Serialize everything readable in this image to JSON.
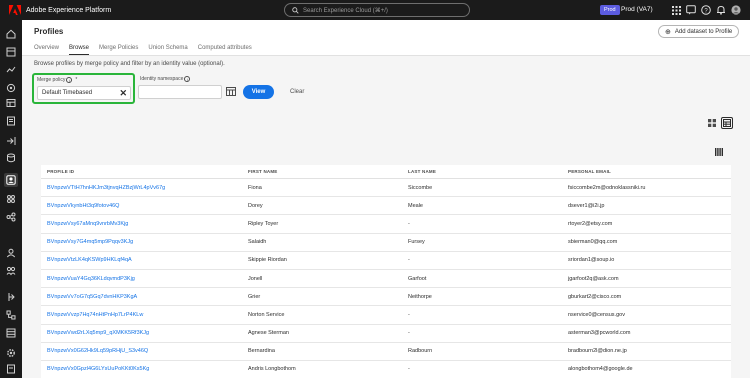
{
  "app": {
    "title": "Adobe Experience Platform"
  },
  "search": {
    "placeholder": "Search Experience Cloud (⌘+/)"
  },
  "org": {
    "badge": "Prod",
    "name": "Prod (VA7)"
  },
  "page": {
    "title": "Profiles",
    "add_dataset_label": "Add dataset to Profile",
    "tabs": [
      "Overview",
      "Browse",
      "Merge Policies",
      "Union Schema",
      "Computed attributes"
    ],
    "active_tab": "Browse",
    "description": "Browse profiles by merge policy and filter by an identity value (optional)."
  },
  "filters": {
    "merge_policy_label": "Merge policy",
    "required_mark": "*",
    "merge_policy_value": "Default Timebased",
    "identity_namespace_label": "Identity namespace",
    "view_label": "View",
    "clear_label": "Clear"
  },
  "table": {
    "headers": [
      "PROFILE ID",
      "FIRST NAME",
      "LAST NAME",
      "PERSONAL EMAIL"
    ],
    "rows": [
      [
        "BVnpzwVTtH7hnHKJm3tjnvqHZBzjWrL4pVv67g",
        "Fiona",
        "Siccombe",
        "fsiccombe2m@odnoklassniki.ru"
      ],
      [
        "BVnpzwVkynbHt3q9fotov46Q",
        "Dorey",
        "Meale",
        "dsever1@i2i.jp"
      ],
      [
        "BVnpzwVsy67aMnq9vnrbMv3Kjg",
        "Ripley Toyer",
        "-",
        "rtoyer2@etsy.com"
      ],
      [
        "BVnpzwVsy7G4mq5mp9Pqqv3KJg",
        "Salaidh",
        "Fursey",
        "sbierman0@qq.com"
      ],
      [
        "BVnpzwVtzLK4qKSWp9HKLqf4qA",
        "Skippie Riordan",
        "-",
        "sriordan1@soup.io"
      ],
      [
        "BVnpzwVuaY4Gq36KLdqvmdP3Kjg",
        "Jonell",
        "Garfoot",
        "jgarfoot2q@ask.com"
      ],
      [
        "BVnpzwVv7oG7q5Gq7dvnHKP3KgA",
        "Grier",
        "Neithorpe",
        "gburkart2@cisco.com"
      ],
      [
        "BVnpzwVvzp7Hq74nHtPnHp7LrP4KLw",
        "Norton Service",
        "-",
        "nservice0@census.gov"
      ],
      [
        "BVnpzwVwd2rLXq5mp9_qXMKK5Rf3KJg",
        "Agnese Sterman",
        "-",
        "asterman3@pcworld.com"
      ],
      [
        "BVnpzwVx0G62Hk9Lq59pRHjU_S3v46Q",
        "Bernardina",
        "Radbourn",
        "bradbourn2l@dion.ne.jp"
      ],
      [
        "BVnpzwVx0Gpzl4G6LYsUuPoKKt0Ks5Kg",
        "Andris Longbothom",
        "-",
        "alongbothom4@google.de"
      ]
    ]
  },
  "icons": {
    "logo": "adobe-logo-icon",
    "search": "search-icon",
    "apps": "apps-grid-icon",
    "help": "help-icon",
    "notifications": "bell-icon",
    "avatar": "avatar-icon"
  },
  "colors": {
    "accent": "#1473e6",
    "highlight": "#2ab53a",
    "logo": "#fa0f00",
    "org_badge": "#5c5ce0"
  }
}
